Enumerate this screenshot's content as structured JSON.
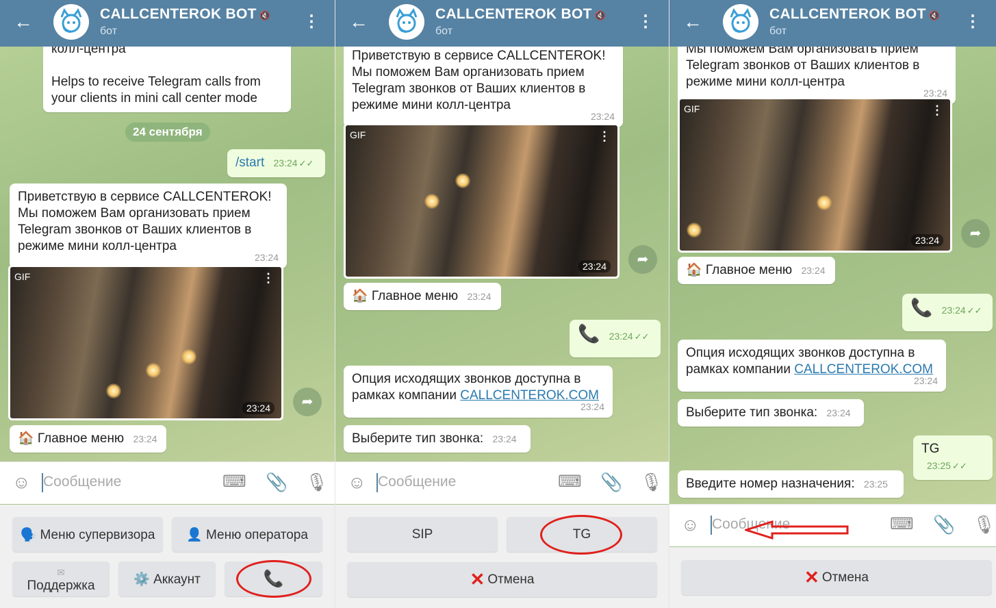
{
  "header": {
    "title": "CALLCENTEROK BOT",
    "subtitle": "бот"
  },
  "panel1": {
    "msg_top_partial": "колл-центра",
    "msg_top_en": "Helps to receive Telegram calls from your clients in mini call center mode",
    "date": "24 сентября",
    "start_cmd": "/start",
    "start_time": "23:24",
    "welcome": "Приветствую в сервисе CALLCENTEROK! Мы поможем Вам организовать прием Telegram звонков от Ваших клиентов в режиме мини колл-центра",
    "welcome_time": "23:24",
    "gif_label": "GIF",
    "gif_time": "23:24",
    "main_menu": "🏠 Главное меню",
    "main_menu_time": "23:24",
    "input_placeholder": "Сообщение",
    "kb_supervisor": "🗣️ Меню супервизора",
    "kb_operator": "👤 Меню оператора",
    "kb_support_icon": "✉",
    "kb_support": "Поддержка",
    "kb_account": "⚙️ Аккаунт",
    "kb_call_icon": "phone-icon"
  },
  "panel2": {
    "welcome": "Приветствую в сервисе CALLCENTEROK! Мы поможем Вам организовать прием Telegram звонков от Ваших клиентов в режиме мини колл-центра",
    "welcome_time": "23:24",
    "gif_label": "GIF",
    "gif_time": "23:24",
    "main_menu": "🏠 Главное меню",
    "main_menu_time": "23:24",
    "call_time": "23:24",
    "option_text": "Опция исходящих звонков доступна в рамках компании ",
    "option_link": "CALLCENTEROK.COM",
    "option_time": "23:24",
    "choose_type": "Выберите тип звонка:",
    "choose_time": "23:24",
    "input_placeholder": "Сообщение",
    "kb_sip": "SIP",
    "kb_tg": "TG",
    "kb_cancel": "Отмена"
  },
  "panel3": {
    "welcome_partial": "Мы поможем Вам организовать прием Telegram звонков от Ваших клиентов в режиме мини колл-центра",
    "welcome_time": "23:24",
    "gif_label": "GIF",
    "gif_time": "23:24",
    "main_menu": "🏠 Главное меню",
    "main_menu_time": "23:24",
    "call_time": "23:24",
    "option_text": "Опция исходящих звонков доступна в рамках компании ",
    "option_link": "CALLCENTEROK.COM",
    "option_time": "23:24",
    "choose_type": "Выберите тип звонка:",
    "choose_time": "23:24",
    "tg": "TG",
    "tg_time": "23:25",
    "enter_number": "Введите номер назначения:",
    "enter_time": "23:25",
    "input_placeholder": "Сообщение",
    "kb_cancel": "Отмена"
  },
  "colors": {
    "header": "#5682a3",
    "out_bubble": "#effdde",
    "annotation": "#e0201c"
  }
}
